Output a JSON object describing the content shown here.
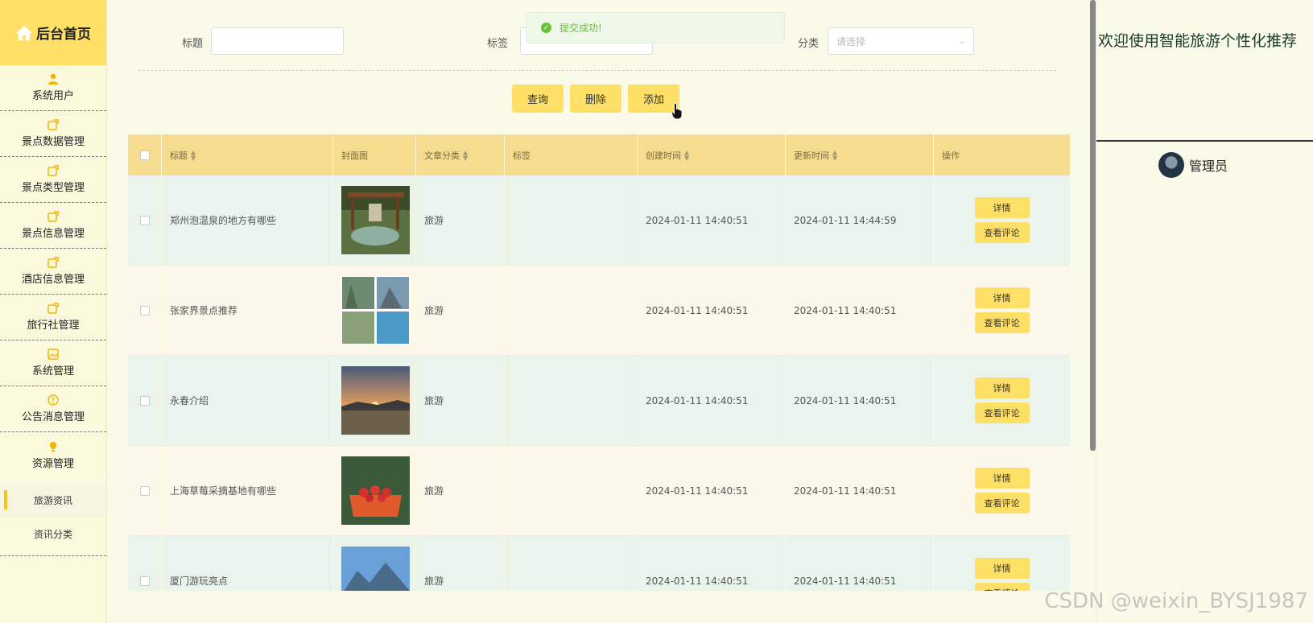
{
  "sidebar": {
    "brand": "后台首页",
    "items": [
      {
        "label": "系统用户",
        "icon": "user-icon"
      },
      {
        "label": "景点数据管理",
        "icon": "edit-icon"
      },
      {
        "label": "景点类型管理",
        "icon": "edit-icon"
      },
      {
        "label": "景点信息管理",
        "icon": "edit-icon"
      },
      {
        "label": "酒店信息管理",
        "icon": "edit-icon"
      },
      {
        "label": "旅行社管理",
        "icon": "edit-icon"
      },
      {
        "label": "系统管理",
        "icon": "image-icon"
      },
      {
        "label": "公告消息管理",
        "icon": "warning-icon"
      },
      {
        "label": "资源管理",
        "icon": "bulb-icon"
      }
    ],
    "sub_items": [
      {
        "label": "旅游资讯",
        "active": true
      },
      {
        "label": "资讯分类",
        "active": false
      }
    ]
  },
  "toast": {
    "message": "提交成功!"
  },
  "search": {
    "title_label": "标题",
    "tag_label": "标签",
    "category_label": "分类",
    "category_placeholder": "请选择"
  },
  "actions": {
    "query": "查询",
    "delete": "删除",
    "add": "添加"
  },
  "table": {
    "headers": [
      "标题",
      "封面图",
      "文章分类",
      "标签",
      "创建时间",
      "更新时间",
      "操作"
    ],
    "rows": [
      {
        "title": "郑州泡温泉的地方有哪些",
        "category": "旅游",
        "tag": "",
        "created": "2024-01-11 14:40:51",
        "updated": "2024-01-11 14:44:59"
      },
      {
        "title": "张家界景点推荐",
        "category": "旅游",
        "tag": "",
        "created": "2024-01-11 14:40:51",
        "updated": "2024-01-11 14:40:51"
      },
      {
        "title": "永春介绍",
        "category": "旅游",
        "tag": "",
        "created": "2024-01-11 14:40:51",
        "updated": "2024-01-11 14:40:51"
      },
      {
        "title": "上海草莓采摘基地有哪些",
        "category": "旅游",
        "tag": "",
        "created": "2024-01-11 14:40:51",
        "updated": "2024-01-11 14:40:51"
      },
      {
        "title": "厦门游玩亮点",
        "category": "旅游",
        "tag": "",
        "created": "2024-01-11 14:40:51",
        "updated": "2024-01-11 14:40:51"
      }
    ],
    "detail_label": "详情",
    "comments_label": "查看评论"
  },
  "right_panel": {
    "welcome": "欢迎使用智能旅游个性化推荐",
    "username": "管理员"
  },
  "watermark": "CSDN @weixin_BYSJ1987"
}
